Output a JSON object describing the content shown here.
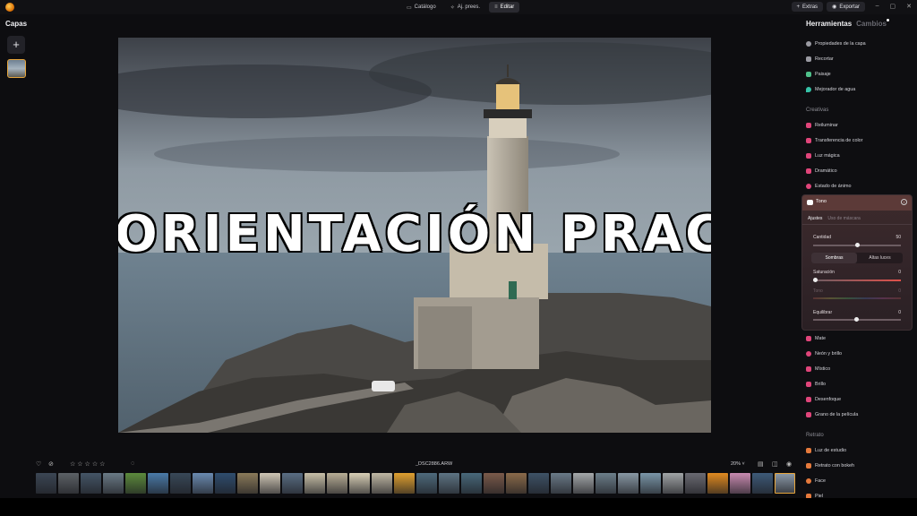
{
  "topbar": {
    "modes": [
      {
        "label": "Catálogo",
        "icon": "folder-icon",
        "active": false
      },
      {
        "label": "Aj. prees.",
        "icon": "presets-icon",
        "active": false
      },
      {
        "label": "Editar",
        "icon": "edit-icon",
        "active": true
      }
    ],
    "extras_label": "Extras",
    "export_label": "Exportar"
  },
  "layers": {
    "title": "Capas"
  },
  "photo": {
    "overlay_text": "ORIENTACIÓN PRACTICA"
  },
  "right_panel": {
    "tab_tools": "Herramientas",
    "tab_changes": "Cambios",
    "tools_top": [
      {
        "label": "Propiedades de la capa",
        "icon": "layer-properties-icon",
        "color": "#9a9aa2"
      },
      {
        "label": "Recortar",
        "icon": "crop-icon",
        "color": "#9a9aa2"
      },
      {
        "label": "Paisaje",
        "icon": "landscape-icon",
        "color": "#4fc08a"
      },
      {
        "label": "Mejorador de agua",
        "icon": "water-icon",
        "color": "#36c3a8"
      }
    ],
    "section_creative": "Creativas",
    "tools_creative": [
      {
        "label": "Reiluminar",
        "icon": "relight-icon",
        "color": "#e0457a"
      },
      {
        "label": "Transferencia de color",
        "icon": "color-transfer-icon",
        "color": "#e0457a"
      },
      {
        "label": "Luz mágica",
        "icon": "magic-light-icon",
        "color": "#e0457a"
      },
      {
        "label": "Dramático",
        "icon": "dramatic-icon",
        "color": "#e0457a"
      },
      {
        "label": "Estado de ánimo",
        "icon": "mood-icon",
        "color": "#e0457a"
      }
    ],
    "expanded_tool": {
      "name": "Tono",
      "tab_adjust": "Ajustes",
      "tab_mask": "Uso de máscara",
      "amount_label": "Cantidad",
      "amount_value": "50",
      "amount_fraction": 0.5,
      "seg_shadows": "Sombras",
      "seg_highlights": "Altas luces",
      "saturation_label": "Saturación",
      "saturation_value": "0",
      "hue_label": "Tono",
      "hue_value": "0",
      "balance_label": "Equilibrar",
      "balance_value": "0"
    },
    "tools_creative_2": [
      {
        "label": "Mate",
        "icon": "matte-icon",
        "color": "#e0457a"
      },
      {
        "label": "Neón y brillo",
        "icon": "neon-icon",
        "color": "#e0457a"
      },
      {
        "label": "Místico",
        "icon": "mystic-icon",
        "color": "#e0457a"
      },
      {
        "label": "Brillo",
        "icon": "glow-icon",
        "color": "#e0457a"
      },
      {
        "label": "Desenfoque",
        "icon": "blur-icon",
        "color": "#e0457a"
      },
      {
        "label": "Grano de la película",
        "icon": "film-grain-icon",
        "color": "#e0457a"
      }
    ],
    "section_portrait": "Retrato",
    "tools_portrait": [
      {
        "label": "Luz de estudio",
        "icon": "studio-light-icon",
        "color": "#e67a3c"
      },
      {
        "label": "Retrato con bokeh",
        "icon": "bokeh-icon",
        "color": "#e67a3c"
      },
      {
        "label": "Face",
        "icon": "face-icon",
        "color": "#e67a3c"
      },
      {
        "label": "Piel",
        "icon": "skin-icon",
        "color": "#e67a3c"
      }
    ]
  },
  "bottombar": {
    "filename": "_DSC2886.ARW",
    "zoom": "20%",
    "rating_stars": 5
  },
  "filmstrip": {
    "thumbs": [
      "#3b4654",
      "#5c6166",
      "#445566",
      "#6a7a86",
      "#5c8a3c",
      "#4a7aa8",
      "#384858",
      "#6a8ab0",
      "#2f4d6e",
      "#8a7a5a",
      "#cfc6b5",
      "#5a6e84",
      "#c8c0a8",
      "#b8ae96",
      "#d8cfb6",
      "#c0b8a4",
      "#e0a030",
      "#4e6a7c",
      "#5e7484",
      "#48687a",
      "#7a5a4a",
      "#8a6a4a",
      "#3e5266",
      "#6a7a88",
      "#a4a8aa",
      "#6c7e8a",
      "#8898a4",
      "#7a96a8",
      "#a0a4a6",
      "#6a6a72",
      "#e08a20",
      "#c88ab0",
      "#3e5a78",
      "#8a98a6"
    ],
    "selected_index": 33
  }
}
